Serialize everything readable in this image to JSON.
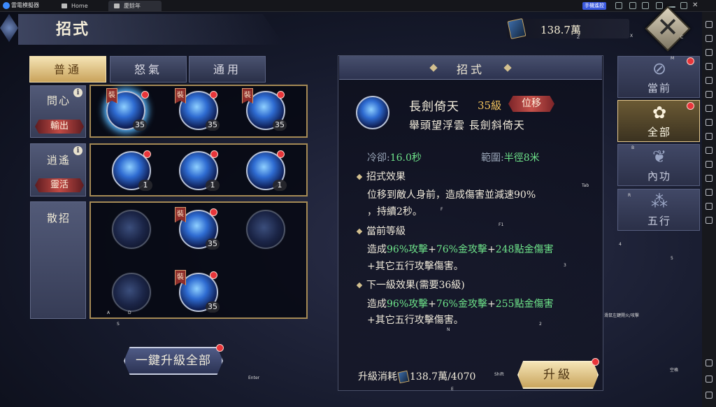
{
  "emulator": {
    "logo_text": "雷電模擬器",
    "tabs": [
      {
        "label": "Home"
      },
      {
        "label": "慶餘年"
      }
    ],
    "remote_label": "手機遙控"
  },
  "header": {
    "title": "招式",
    "currency_value": "138.7萬"
  },
  "left": {
    "tabs": [
      {
        "label": "普通",
        "active": true
      },
      {
        "label": "怒氣"
      },
      {
        "label": "通用"
      }
    ],
    "rows": [
      {
        "name": "問心",
        "info": "i",
        "role": "輸出",
        "skills": [
          {
            "level": "35",
            "equipped": true,
            "red_dot": true,
            "selected": true
          },
          {
            "level": "35",
            "equipped": true,
            "red_dot": true
          },
          {
            "level": "35",
            "equipped": true,
            "red_dot": true
          }
        ]
      },
      {
        "name": "逍遙",
        "info": "i",
        "role": "靈活",
        "skills": [
          {
            "level": "1",
            "red_dot": true
          },
          {
            "level": "1",
            "red_dot": true
          },
          {
            "level": "1",
            "red_dot": true
          }
        ]
      },
      {
        "name": "散招",
        "skills": [
          {
            "level": ""
          },
          {
            "level": "35",
            "equipped": true,
            "red_dot": true
          },
          {
            "level": ""
          },
          {
            "level": ""
          },
          {
            "level": "35",
            "equipped": true,
            "red_dot": true
          }
        ]
      }
    ],
    "equip_tag": "裝",
    "upgrade_all_label": "一鍵升級全部"
  },
  "detail": {
    "title": "招式",
    "skill_name": "長劍倚天",
    "skill_level": "35級",
    "skill_type": "位移",
    "skill_subtitle": "舉頭望浮雲 長劍斜倚天",
    "cooldown_label": "冷卻:",
    "cooldown_value": "16.0秒",
    "range_label": "範圍:",
    "range_value": "半徑8米",
    "effect_title": "招式效果",
    "effect_line1": "位移到敵人身前，造成傷害並減速90%",
    "effect_line2": "，持續2秒。",
    "current_title": "當前等級",
    "current_prefix": "造成",
    "current_g1": "96%攻擊",
    "current_plus1": "+",
    "current_g2": "76%金攻擊",
    "current_plus2": "+",
    "current_g3": "248點金傷害",
    "current_line2": "+其它五行攻擊傷害。",
    "next_title": "下一級效果(需要36級)",
    "next_prefix": "造成",
    "next_g1": "96%攻擊",
    "next_plus1": "+",
    "next_g2": "76%金攻擊",
    "next_plus2": "+",
    "next_g3": "255點金傷害",
    "next_line2": "+其它五行攻擊傷害。",
    "cost_label": "升級消耗",
    "cost_value": "138.7萬/4070",
    "upgrade_label": "升級"
  },
  "categories": [
    {
      "label": "當前",
      "icon": "target-icon",
      "red_dot": true
    },
    {
      "label": "全部",
      "icon": "flower-icon",
      "active": true,
      "red_dot": true
    },
    {
      "label": "內功",
      "icon": "knot-icon"
    },
    {
      "label": "五行",
      "icon": "circles-icon"
    }
  ],
  "key_hints": {
    "z": "Z",
    "x": "X",
    "c": "C",
    "m": "M",
    "b": "B",
    "r": "R",
    "tab": "Tab",
    "f": "F",
    "f1": "F1",
    "three": "3",
    "two": "2",
    "four": "4",
    "five": "5",
    "a": "A",
    "d": "D",
    "s": "S",
    "n": "N",
    "e": "E",
    "enter": "Enter",
    "shift": "Shift",
    "space": "空格",
    "fire": "滑鼠左鍵開火/攻擊"
  }
}
